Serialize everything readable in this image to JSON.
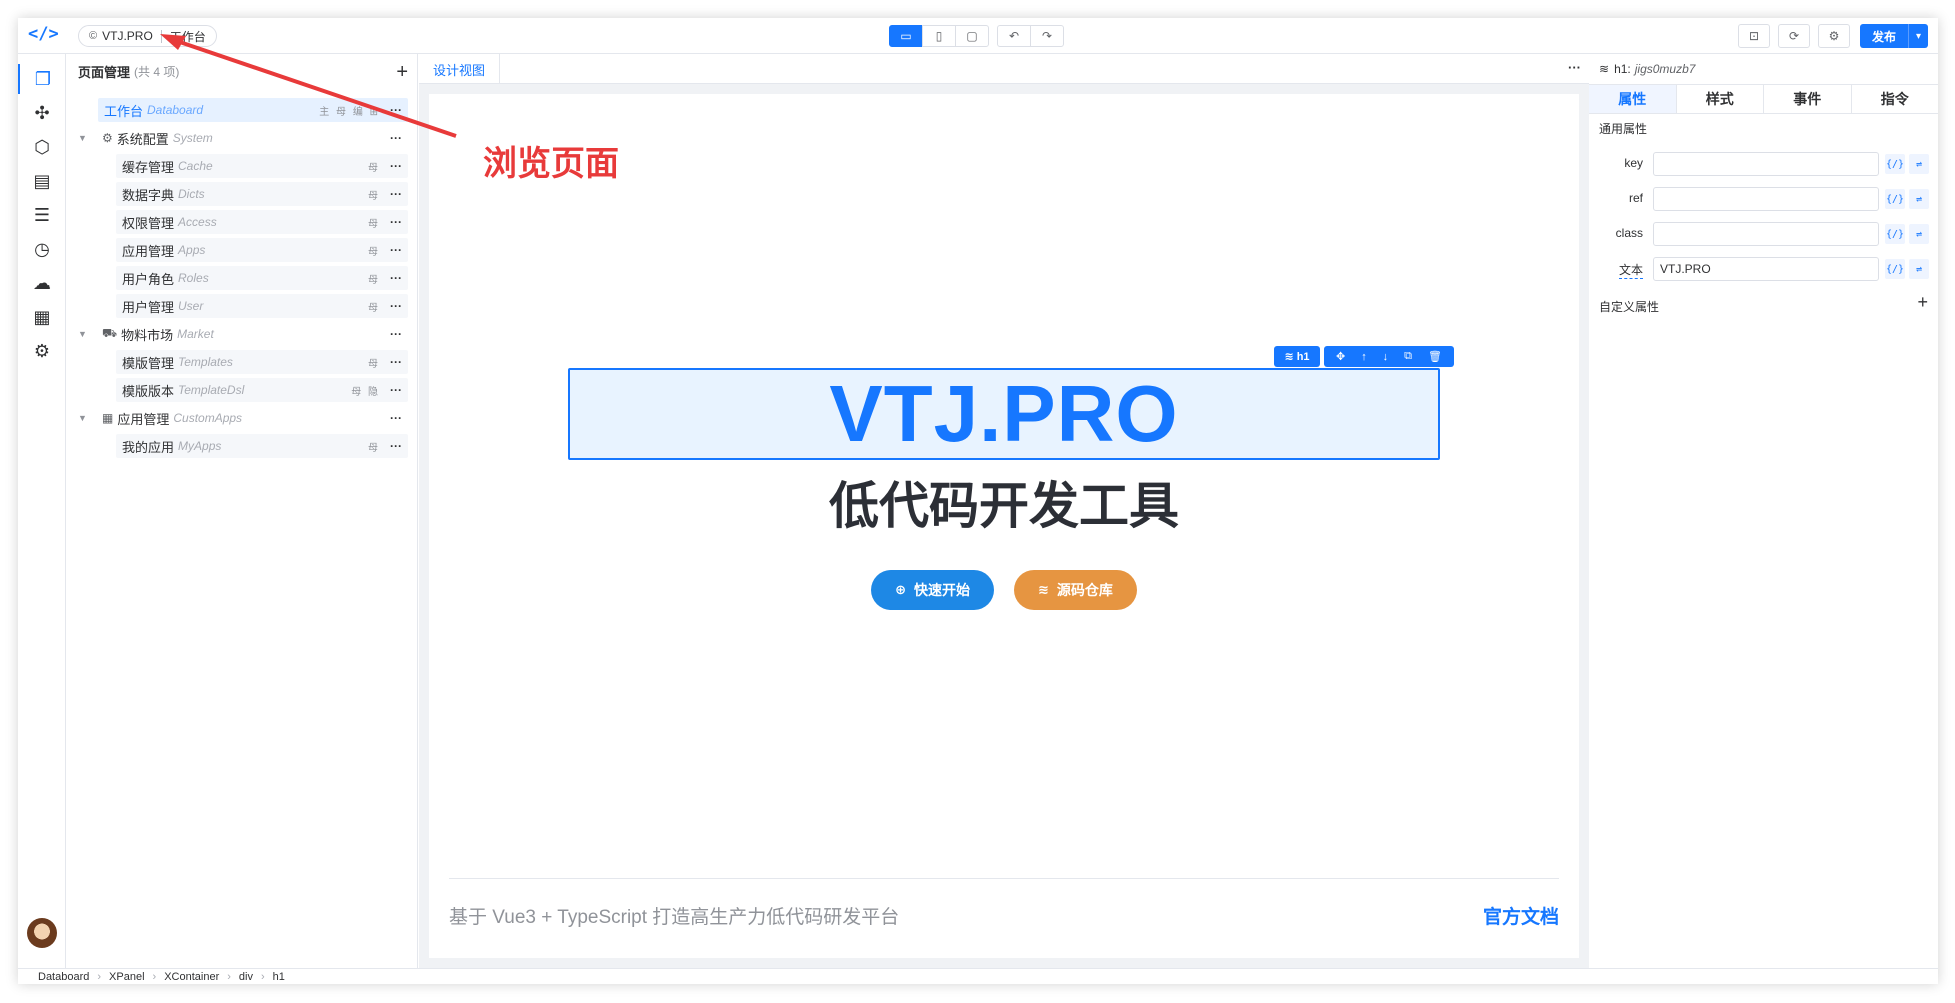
{
  "topbar": {
    "project": "VTJ.PRO",
    "page": "工作台",
    "publish_label": "发布"
  },
  "pages": {
    "title": "页面管理",
    "count": "(共 4 项)",
    "rows": [
      {
        "name": "工作台",
        "en": "Databoard",
        "tags": "主 母 编 ⊞",
        "selected": true
      },
      {
        "name": "系统配置",
        "en": "System",
        "tags": ""
      },
      {
        "name": "缓存管理",
        "en": "Cache",
        "tags": "母"
      },
      {
        "name": "数据字典",
        "en": "Dicts",
        "tags": "母"
      },
      {
        "name": "权限管理",
        "en": "Access",
        "tags": "母"
      },
      {
        "name": "应用管理",
        "en": "Apps",
        "tags": "母"
      },
      {
        "name": "用户角色",
        "en": "Roles",
        "tags": "母"
      },
      {
        "name": "用户管理",
        "en": "User",
        "tags": "母"
      },
      {
        "name": "物料市场",
        "en": "Market",
        "tags": ""
      },
      {
        "name": "模版管理",
        "en": "Templates",
        "tags": "母"
      },
      {
        "name": "模版版本",
        "en": "TemplateDsl",
        "tags": "母 隐"
      },
      {
        "name": "应用管理",
        "en": "CustomApps",
        "tags": ""
      },
      {
        "name": "我的应用",
        "en": "MyApps",
        "tags": "母"
      }
    ]
  },
  "center": {
    "tab": "设计视图",
    "h1_tag": "h1",
    "headline": "VTJ.PRO",
    "subtitle": "低代码开发工具",
    "btn_start": "快速开始",
    "btn_repo": "源码仓库",
    "footer_text": "基于 Vue3 + TypeScript 打造高生产力低代码研发平台",
    "footer_link": "官方文档"
  },
  "props": {
    "title": "h1:",
    "id": "jigs0muzb7",
    "tabs": [
      "属性",
      "样式",
      "事件",
      "指令"
    ],
    "section_common": "通用属性",
    "fields": [
      {
        "label": "key",
        "value": ""
      },
      {
        "label": "ref",
        "value": ""
      },
      {
        "label": "class",
        "value": ""
      },
      {
        "label": "文本",
        "value": "VTJ.PRO"
      }
    ],
    "section_custom": "自定义属性"
  },
  "status": {
    "crumbs": [
      "Databoard",
      "XPanel",
      "XContainer",
      "div",
      "h1"
    ]
  },
  "annotation": "浏览页面"
}
